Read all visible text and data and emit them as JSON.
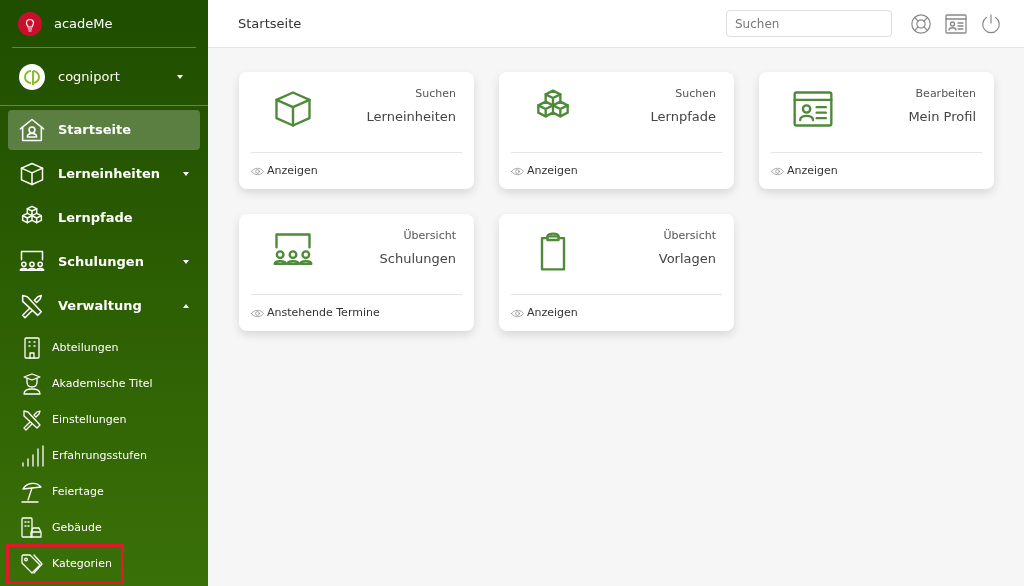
{
  "sidebar": {
    "brand": "acadeMe",
    "org": {
      "name": "cogniport",
      "expanded": false
    },
    "items": [
      {
        "label": "Startseite",
        "selected": true
      },
      {
        "label": "Lerneinheiten",
        "selected": false,
        "expanded": false
      },
      {
        "label": "Lernpfade",
        "selected": false
      },
      {
        "label": "Schulungen",
        "selected": false,
        "expanded": false
      },
      {
        "label": "Verwaltung",
        "selected": false,
        "expanded": true,
        "children": [
          {
            "label": "Abteilungen",
            "highlighted": false
          },
          {
            "label": "Akademische Titel",
            "highlighted": false
          },
          {
            "label": "Einstellungen",
            "highlighted": false
          },
          {
            "label": "Erfahrungsstufen",
            "highlighted": false
          },
          {
            "label": "Feiertage",
            "highlighted": false
          },
          {
            "label": "Gebäude",
            "highlighted": false
          },
          {
            "label": "Kategorien",
            "highlighted": true
          }
        ]
      }
    ]
  },
  "header": {
    "title": "Startseite",
    "search": {
      "placeholder": "Suchen"
    }
  },
  "cards": [
    {
      "caption": "Suchen",
      "title": "Lerneinheiten",
      "link": "Anzeigen"
    },
    {
      "caption": "Suchen",
      "title": "Lernpfade",
      "link": "Anzeigen"
    },
    {
      "caption": "Bearbeiten",
      "title": "Mein Profil",
      "link": "Anzeigen"
    },
    {
      "caption": "Übersicht",
      "title": "Schulungen",
      "link": "Anstehende Termine"
    },
    {
      "caption": "Übersicht",
      "title": "Vorlagen",
      "link": "Anzeigen"
    }
  ]
}
